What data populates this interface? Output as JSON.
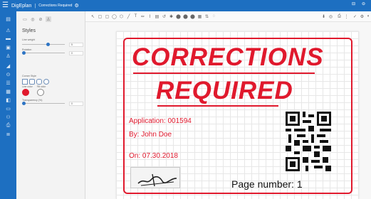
{
  "app": {
    "logo_glyph": "☰",
    "name": "DigEplan",
    "separator": "|",
    "document": "Corrections Required",
    "settings_glyph": "⚙",
    "window_controls": [
      "⊟",
      "⊖"
    ]
  },
  "rail_icons": [
    {
      "name": "pages-icon",
      "glyph": "▤"
    },
    {
      "name": "warning-icon",
      "glyph": "⚠"
    },
    {
      "name": "comment-icon",
      "glyph": "▬"
    },
    {
      "name": "image-icon",
      "glyph": "▣"
    },
    {
      "name": "stamp-icon",
      "glyph": "♙"
    },
    {
      "name": "measure-icon",
      "glyph": "◢"
    },
    {
      "name": "check-icon",
      "glyph": "⊙"
    },
    {
      "name": "list-icon",
      "glyph": "☰"
    },
    {
      "name": "layers-icon",
      "glyph": "▦"
    },
    {
      "name": "compare-icon",
      "glyph": "◧"
    },
    {
      "name": "document-icon",
      "glyph": "▭"
    },
    {
      "name": "group-icon",
      "glyph": "⚇"
    },
    {
      "name": "print-icon",
      "glyph": "⎙"
    },
    {
      "name": "history-icon",
      "glyph": "≣"
    }
  ],
  "panel": {
    "tabs": [
      "▭",
      "◎",
      "⊘",
      "♙"
    ],
    "title": "Styles",
    "line_weight_label": "Line weight",
    "line_weight_value": "5",
    "rotation_label": "Rotation",
    "rotation_value": "0",
    "corner_style_label": "Corner Style",
    "line_color_label": "Line color",
    "fill_color_label": "Fill color",
    "transparency_label": "Transparency (%)",
    "transparency_value": "0",
    "line_color": "#e0192d",
    "fill_color": "#ffffff"
  },
  "toolbar_left": [
    "↖",
    "▢",
    "▢",
    "◯",
    "⬡",
    "╱",
    "T",
    "✏",
    "⌇",
    "▤",
    "↺",
    "✱",
    "⬤",
    "⬤",
    "⬤",
    "▦",
    "⇅",
    "◌"
  ],
  "toolbar_right": [
    "⬇",
    "◎",
    "⎙",
    "⋮",
    "✓",
    "⚙",
    "◐"
  ],
  "stamp": {
    "line1": "CORRECTIONS",
    "line2": "REQUIRED",
    "application": "Application:  001594",
    "by": "By:  John Doe",
    "on": "On:  07.30.2018",
    "page_number": "Page number:  1",
    "color": "#e0192d"
  }
}
